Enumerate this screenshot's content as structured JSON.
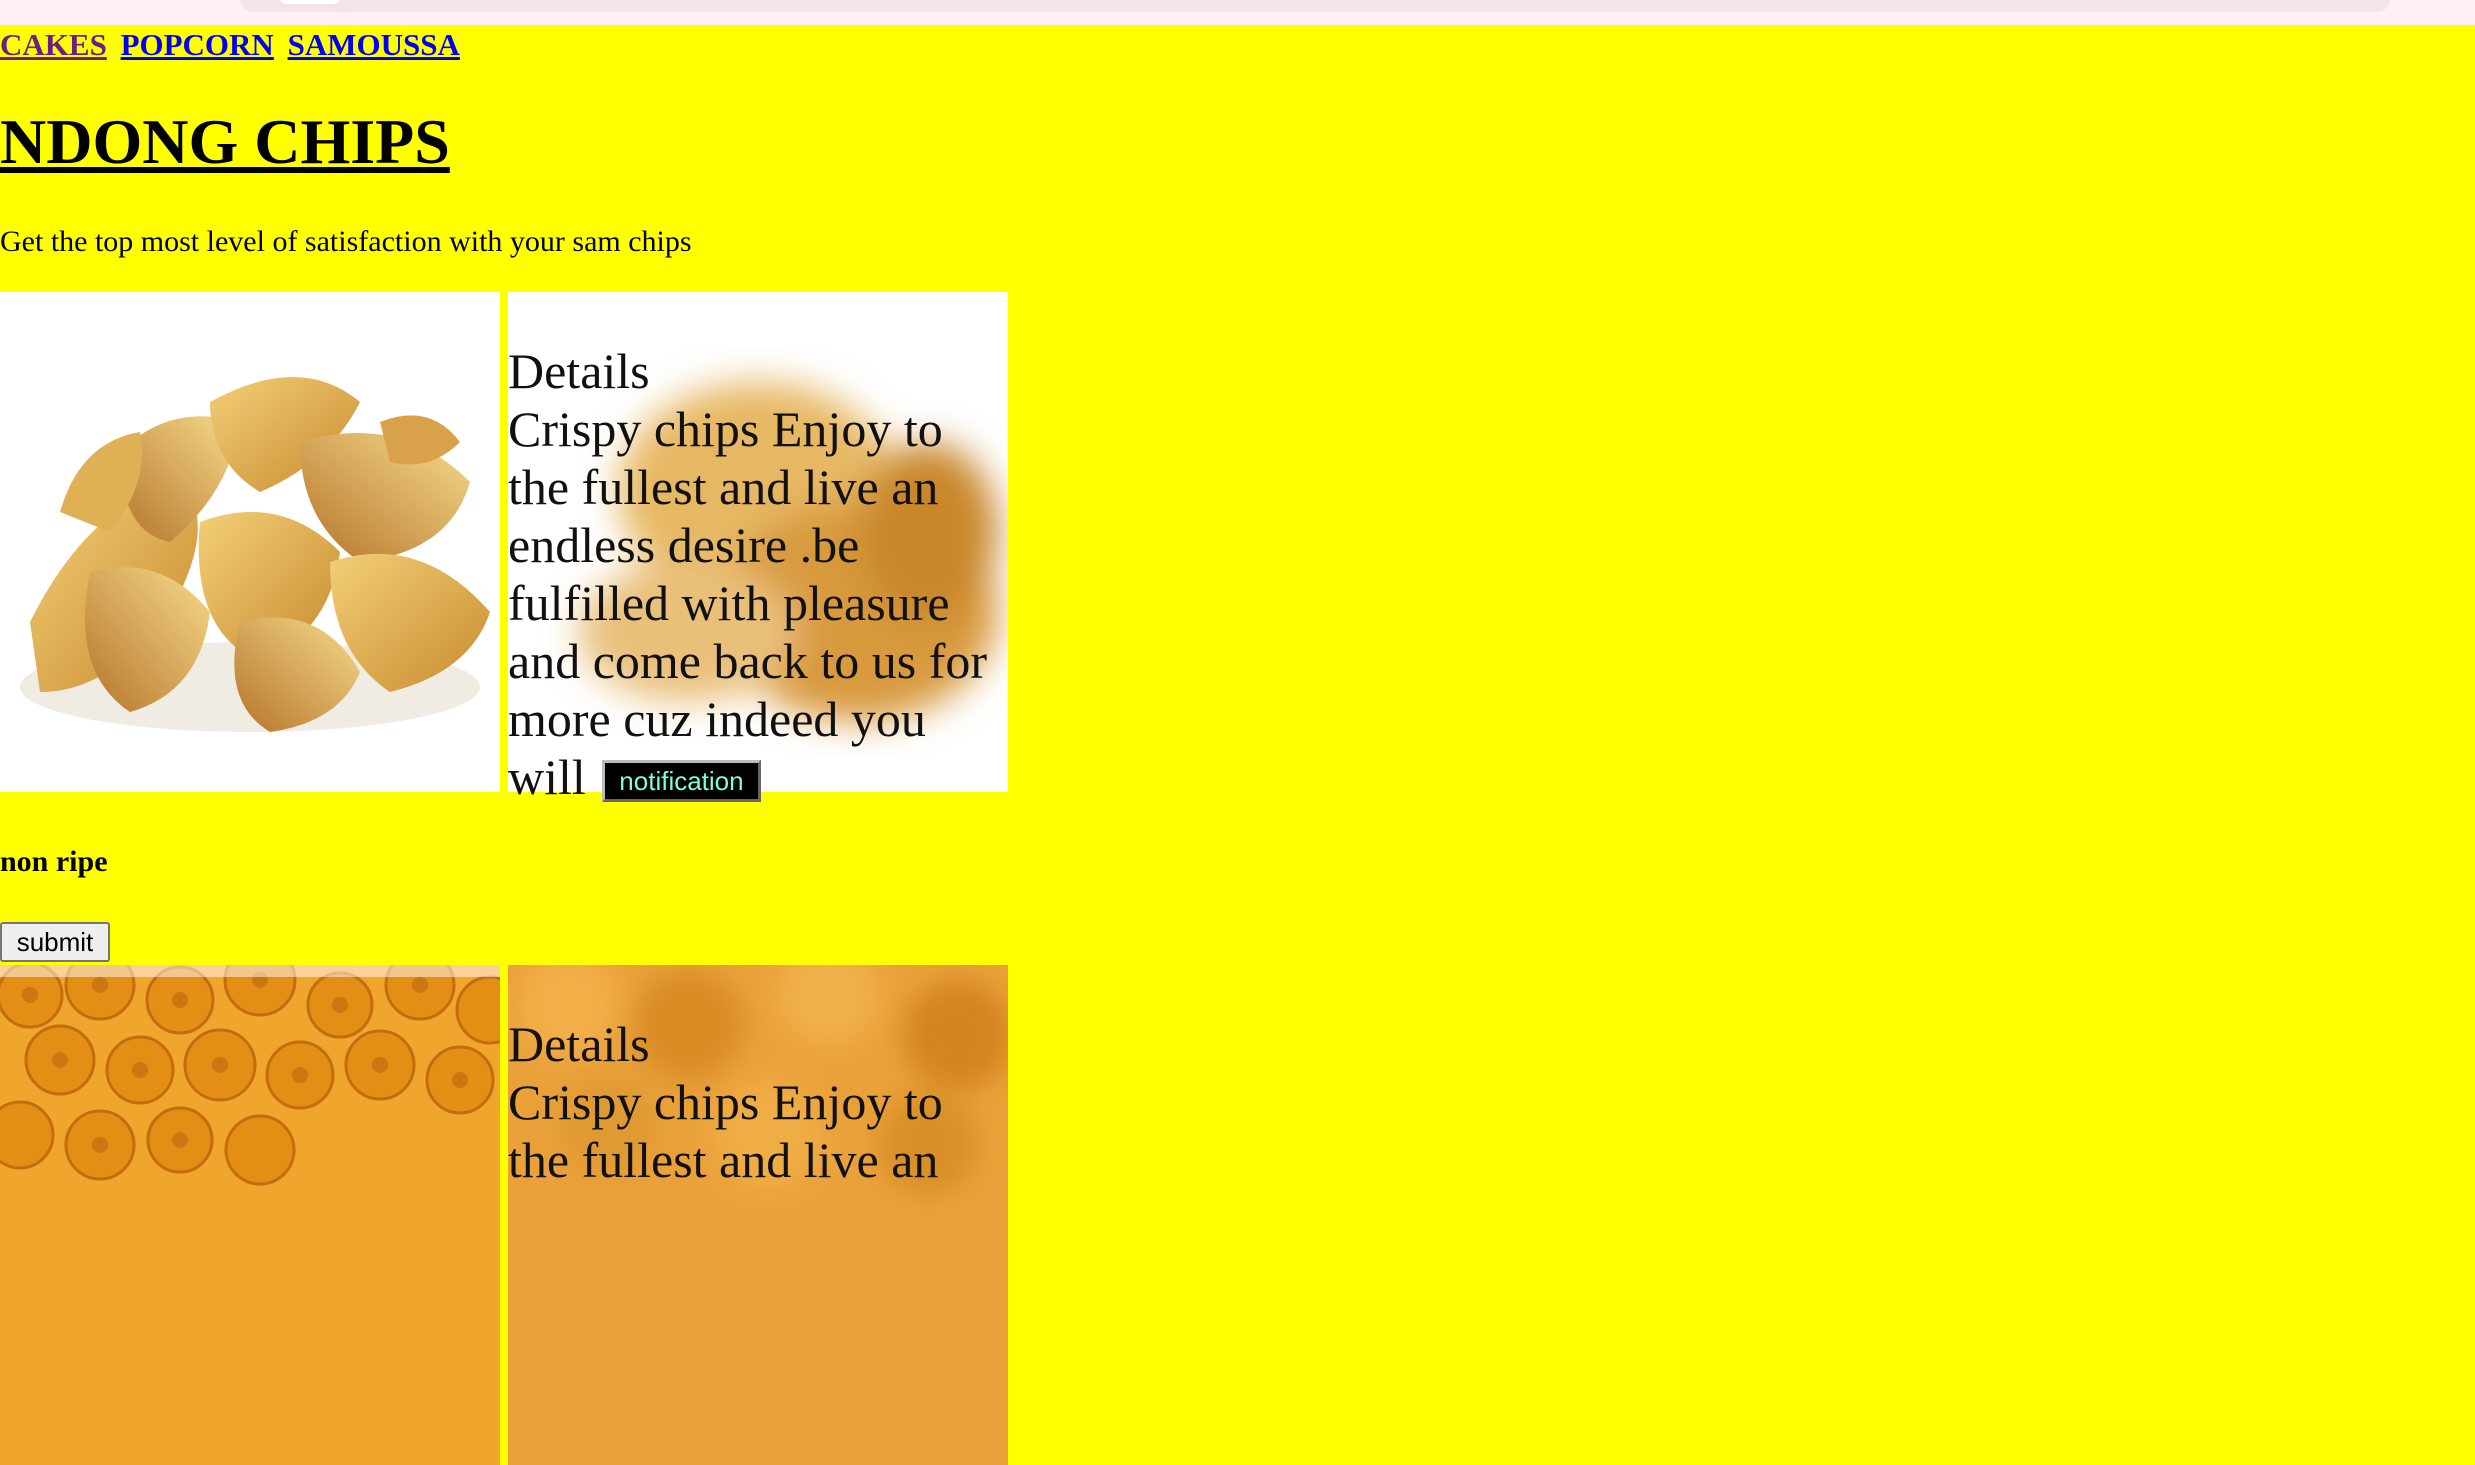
{
  "nav": {
    "links": [
      {
        "label": "CAKES"
      },
      {
        "label": "POPCORN"
      },
      {
        "label": "SAMOUSSA"
      }
    ]
  },
  "page": {
    "title": "NDONG CHIPS",
    "tagline": "Get the top most level of satisfaction with your sam chips"
  },
  "cards": [
    {
      "details_heading": "Details",
      "details_text": "Crispy chips Enjoy to the fullest and live an endless desire .be fulfilled with pleasure and come back to us for more cuz indeed you will",
      "button_label": "notification"
    },
    {
      "details_heading": "Details",
      "details_text": "Crispy chips Enjoy to the fullest and live an"
    }
  ],
  "status": {
    "label": "non ripe"
  },
  "form": {
    "submit_label": "submit"
  },
  "colors": {
    "page_background": "#ffff00",
    "visited_link": "#6b1d8a",
    "link": "#0000ee",
    "notification_text": "#7fffd4"
  }
}
